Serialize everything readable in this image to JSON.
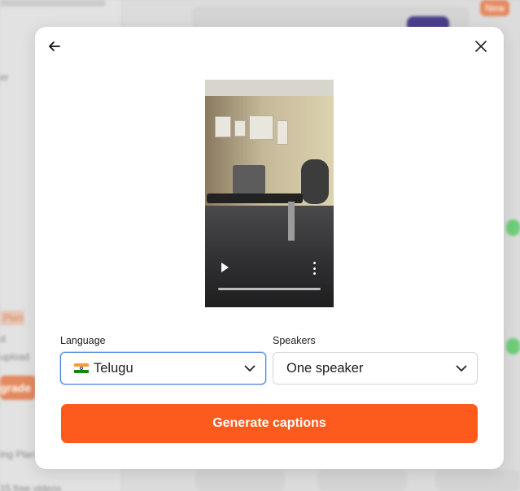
{
  "background": {
    "plan_badge": "Plan",
    "upgrade_label": "grade",
    "new_badge": "New",
    "sidebar_texts": [
      "er",
      "d",
      "upload",
      "ing Plan",
      "15 free videos"
    ]
  },
  "modal": {
    "back_icon": "arrow-left-icon",
    "close_icon": "close-icon",
    "video": {
      "play_icon": "play-icon",
      "more_icon": "more-vertical-icon"
    },
    "language": {
      "label": "Language",
      "value": "Telugu",
      "flag": "india-flag-icon"
    },
    "speakers": {
      "label": "Speakers",
      "value": "One speaker"
    },
    "cta_label": "Generate captions",
    "colors": {
      "accent": "#fd5a1e",
      "focus_border": "#4a7fe0"
    }
  }
}
